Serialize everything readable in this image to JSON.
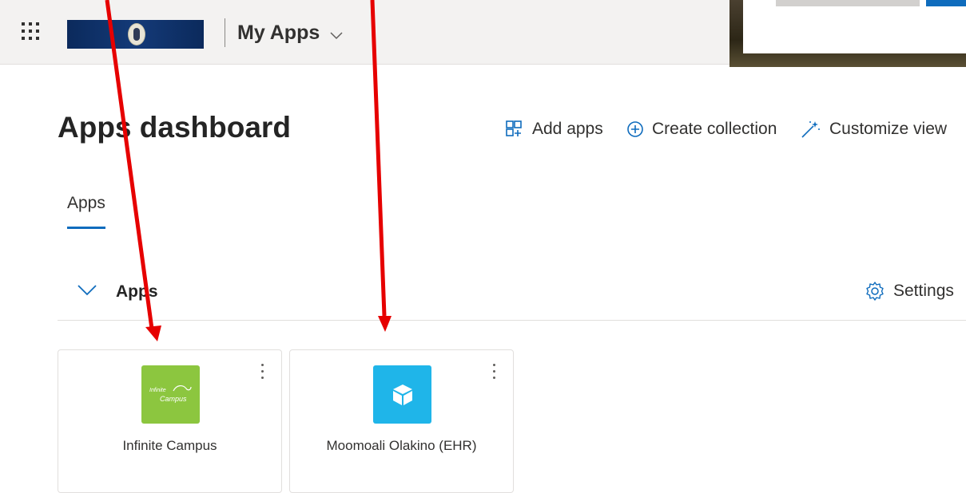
{
  "header": {
    "brand": "My Apps",
    "org_logo": "district-seal-banner"
  },
  "page": {
    "title": "Apps dashboard"
  },
  "commands": {
    "add_apps": "Add apps",
    "create_collection": "Create collection",
    "customize_view": "Customize view"
  },
  "tabs": [
    {
      "label": "Apps",
      "selected": true
    }
  ],
  "section": {
    "title": "Apps",
    "settings_label": "Settings"
  },
  "apps": [
    {
      "name": "Infinite Campus",
      "icon_text_1": "Infinite",
      "icon_text_2": "Campus",
      "icon_color": "#8cc63f"
    },
    {
      "name": "Moomoali Olakino (EHR)",
      "icon": "cube-icon",
      "icon_color": "#1fb5e9"
    }
  ],
  "colors": {
    "accent": "#0f6cbd",
    "annotation_arrow": "#e60000",
    "topbar": "#f3f2f1"
  }
}
